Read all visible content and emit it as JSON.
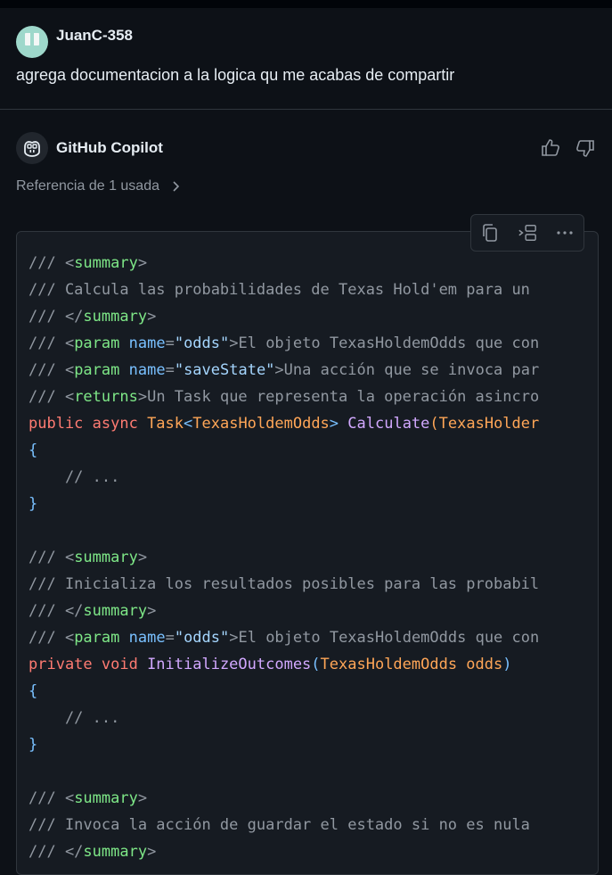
{
  "user": {
    "name": "JuanC-358",
    "message": "agrega documentacion a la logica qu me acabas de compartir"
  },
  "assistant": {
    "name": "GitHub Copilot",
    "references": "Referencia de 1 usada"
  },
  "code": {
    "l1": {
      "c1": "/// <",
      "t": "summary",
      "c2": ">"
    },
    "l2": {
      "c": "/// Calcula las probabilidades de Texas Hold'em para un"
    },
    "l3": {
      "c1": "/// </",
      "t": "summary",
      "c2": ">"
    },
    "l4": {
      "c1": "/// <",
      "t": "param",
      "sp": " ",
      "attr": "name",
      "eq": "=",
      "str": "\"odds\"",
      "c2": ">El objeto TexasHoldemOdds que con"
    },
    "l5": {
      "c1": "/// <",
      "t": "param",
      "sp": " ",
      "attr": "name",
      "eq": "=",
      "str": "\"saveState\"",
      "c2": ">Una acción que se invoca par"
    },
    "l6": {
      "c1": "/// <",
      "t": "returns",
      "c2": ">Un Task que representa la operación asincro"
    },
    "l7": {
      "k1": "public async ",
      "ty1": "Task",
      "p1": "<",
      "ty2": "TexasHoldemOdds",
      "p2": "> ",
      "f": "Calculate",
      "p3": "(",
      "ty3": "TexasHolder"
    },
    "l8": {
      "b": "{"
    },
    "l9": {
      "c": "    // ..."
    },
    "l10": {
      "b": "}"
    },
    "l12": {
      "c1": "/// <",
      "t": "summary",
      "c2": ">"
    },
    "l13": {
      "c": "/// Inicializa los resultados posibles para las probabil"
    },
    "l14": {
      "c1": "/// </",
      "t": "summary",
      "c2": ">"
    },
    "l15": {
      "c1": "/// <",
      "t": "param",
      "sp": " ",
      "attr": "name",
      "eq": "=",
      "str": "\"odds\"",
      "c2": ">El objeto TexasHoldemOdds que con"
    },
    "l16": {
      "k1": "private void ",
      "f": "InitializeOutcomes",
      "p1": "(",
      "ty1": "TexasHoldemOdds odds",
      "p2": ")"
    },
    "l17": {
      "b": "{"
    },
    "l18": {
      "c": "    // ..."
    },
    "l19": {
      "b": "}"
    },
    "l21": {
      "c1": "/// <",
      "t": "summary",
      "c2": ">"
    },
    "l22": {
      "c": "/// Invoca la acción de guardar el estado si no es nula"
    },
    "l23": {
      "c1": "/// </",
      "t": "summary",
      "c2": ">"
    }
  },
  "icons": {
    "copy": "copy-icon",
    "insert": "insert-icon",
    "more": "more-icon",
    "thumbs_up": "thumbs-up-icon",
    "thumbs_down": "thumbs-down-icon",
    "chevron": "chevron-right-icon"
  },
  "colors": {
    "background": "#0d1117",
    "code_background": "#161b22",
    "comment": "#9198a1",
    "tag": "#7ee787",
    "keyword": "#ff7b72",
    "type": "#ffa657",
    "function": "#d2a8ff",
    "string": "#a5d6ff"
  }
}
